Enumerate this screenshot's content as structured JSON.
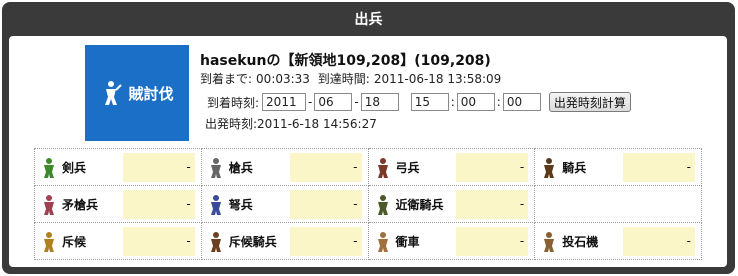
{
  "window": {
    "title": "出兵"
  },
  "mission": {
    "icon_label": "賊討伐",
    "icon_name": "bandit-subjugation-icon",
    "destination": "hasekunの【新領地109,208】(109,208)",
    "until_arrival_label": "到着まで:",
    "until_arrival_value": "00:03:33",
    "arrival_time_label": "到達時間:",
    "arrival_time_value": "2011-06-18 13:58:09",
    "arrival_input_label": "到着時刻:",
    "year": "2011",
    "month": "06",
    "day": "18",
    "hour": "15",
    "minute": "00",
    "second": "00",
    "calc_button": "出発時刻計算",
    "departure_label": "出発時刻:",
    "departure_value": "2011-6-18 14:56:27"
  },
  "units": {
    "rows": [
      [
        {
          "name": "剣兵",
          "value": "-",
          "icon": "swordsman-icon"
        },
        {
          "name": "槍兵",
          "value": "-",
          "icon": "spearman-icon"
        },
        {
          "name": "弓兵",
          "value": "-",
          "icon": "archer-icon"
        },
        {
          "name": "騎兵",
          "value": "-",
          "icon": "cavalry-icon"
        }
      ],
      [
        {
          "name": "矛槍兵",
          "value": "-",
          "icon": "pikeman-icon"
        },
        {
          "name": "弩兵",
          "value": "-",
          "icon": "crossbowman-icon"
        },
        {
          "name": "近衛騎兵",
          "value": "-",
          "icon": "guard-cavalry-icon"
        },
        null
      ],
      [
        {
          "name": "斥候",
          "value": "-",
          "icon": "scout-icon"
        },
        {
          "name": "斥候騎兵",
          "value": "-",
          "icon": "scout-cavalry-icon"
        },
        {
          "name": "衝車",
          "value": "-",
          "icon": "battering-ram-icon"
        },
        {
          "name": "投石機",
          "value": "-",
          "icon": "catapult-icon"
        }
      ]
    ]
  },
  "colors": {
    "frame": "#3a3a3a",
    "mission_bg": "#1b6fc6",
    "value_bg": "#fbf6c8"
  }
}
